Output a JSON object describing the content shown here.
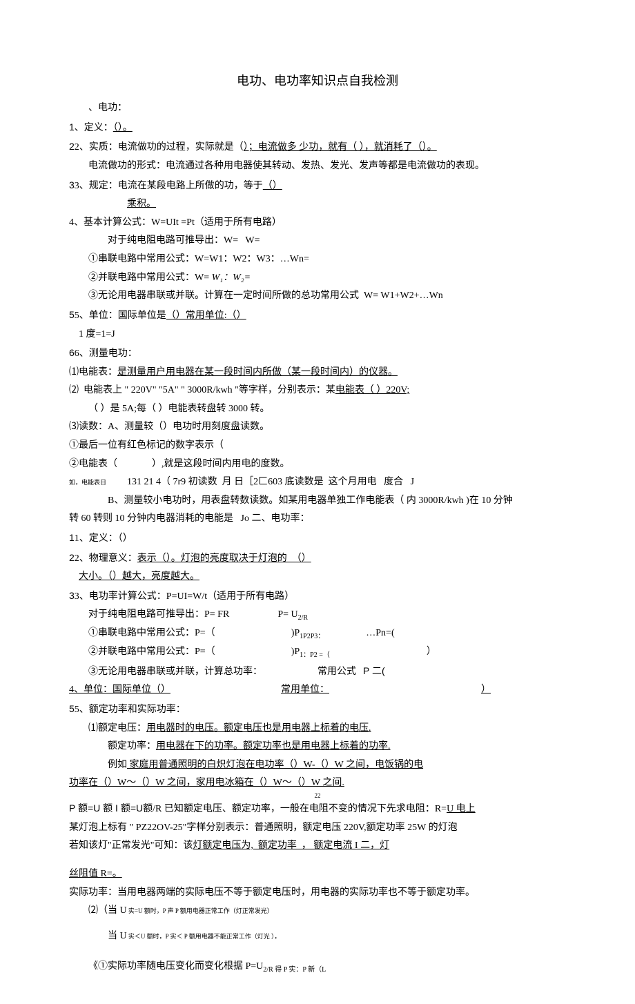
{
  "title": "电功、电功率知识点自我检测",
  "s1_header": "、电功：",
  "l1a": "1、定义：",
  "l1b": "（）。",
  "l2a": "2、实质：电流做功的过程，实际就是（",
  "l2b": "）；电流做多 少功，就有（ ），就消耗了（）。",
  "l3": "电流做功的形式：电流通过各种用电器使其转动、发热、发光、发声等都是电流做功的表现。",
  "l4a": "3、规定：电流在某段电路上所做的功，等于",
  "l4b": "（）",
  "l5": "乘积。",
  "l6": "4、基本计算公式：W=UIt =Pt（适用于所有电路）",
  "l7": "对于纯电阻电路可推导出：W=   W=",
  "l8": "①串联电路中常用公式：W=W",
  "l8b": "1：W2：W3：…Wn=",
  "l9": "②并联电路中常用公式：W= ",
  "l9b": "W₁：W₂=",
  "l10": "③无论用电器串联或并联。计算在一定时间所做的总功常用公式  W= W",
  "l10b": "1+W2+…Wn",
  "l11a": "5、单位：国际单位是",
  "l11b": "（）常用单位:（）",
  "l12": "1 度=1=J",
  "l13": "6、测量电功：",
  "l14": "⑴电能表：",
  "l14b": "是测量用户用电器在某一段时间内所做（某一段时间内）的仪器。",
  "l15a": "⑵  电能表上 \" 220V\" \"5A\" \" 3000R/kwh \"等字样，分别表示：某",
  "l15b": "电能表（ ）220V;",
  "l16": "（ ）是 5A;每（ ）电能表转盘转 3000 转。",
  "l17": "⑶读数：A、测量较（）电功时用刻度盘读数。",
  "l18": "①最后一位有红色标记的数字表示（",
  "l19a": "②电能表（",
  "l19b": "）,就是这段时间内用电的度数。",
  "l20a": "如，电能表日",
  "l20b": "131 21 4（ 7r9 初读数  月 日［2匚603 底读数是  这个月用电   度合   J",
  "l21": "B、测量较小电功时，用表盘转数读数。如某用电器单独工作电能表（ 内 3000R/kwh )在 10 分钟",
  "l22": "转 60 转则 10 分钟内电器消耗的电能是   Jo 二、电功率：",
  "l23": "1、定义：（）",
  "l24a": "2、物理意义：",
  "l24b": "表示（）。灯泡的亮度取决于灯泡的  （）",
  "l25": "大小。（）越大，亮度越大。",
  "l26": "3、电功率计算公式：P=UI=W/t（适用于所有电路）",
  "l27a": "对于纯电阻电路可推导出：P= FR",
  "l27b": "P= U",
  "l27c": "2/R",
  "l28a": "①串联电路中常用公式：P=（",
  "l28b": ")P",
  "l28c": "1P2P3：",
  "l28d": "…Pn=(",
  "l29a": "②并联电路中常用公式：P=（",
  "l29b": ")P",
  "l29c": "1：P2 =（",
  "l29d": "）",
  "l30a": "③无论用电器串联或并联，计算总功率：",
  "l30b": "常用公式",
  "l30c": "P 二(",
  "l31a": "4、单位：国际单位（）",
  "l31b": "常用单位：",
  "l31c": "）",
  "l32": "5、额定功率和实际功率：",
  "l33a": "⑴额定电压：",
  "l33b": "用电器时的电压。额定电压也是用电器上标着的电压.",
  "l34a": "额定功率：",
  "l34b": "用电器在下的功率。额定功率也是用电器上标着的功率.",
  "l35a": "例如",
  "l35b": " 家庭用普通照明的白炽灯泡在电功率（）W-（）W 之间，电饭锅的电",
  "l36": "功率在（）W〜（）W 之间，家用电冰箱在（）W〜（）W 之间.",
  "l37a": "P 额=U 额 I 额=U",
  "l37b": "额/R 已知额定电压、额定功率，一般在电阻不变的情况下先求电阻：R=",
  "l37c": "U 电上",
  "l38": "某灯泡上标有 \" PZ22OV-25\"字样分别表示：普通照明，额定电压 220V,额定功率 25W 的灯泡",
  "l39a": "若知该灯\"正常发光\"可知：该",
  "l39b": "灯额定电压为,  额定功率  ， 额定电流 I 二，灯",
  "l40": "丝阻值 R=。",
  "l41": "实际功率：当用电器两端的实际电压不等于额定电压时，用电器的实际功率也不等于额定功率。",
  "l42a": "⑵（当 U",
  "l42b": " 实=U",
  "l42c": " 额时，P 声 P 额用电器正常工作（灯正常发光）",
  "l43a": "当 U",
  "l43b": " 实＜U",
  "l43c": " 额时，P",
  "l43d": " 实＜ P",
  "l43e": " 额用电器不能正常工作（灯光 ），",
  "l44": "《①实际功率随电压变化而变化根据 P=U",
  "l44b": "2/R 得 P 实：P 新（L"
}
